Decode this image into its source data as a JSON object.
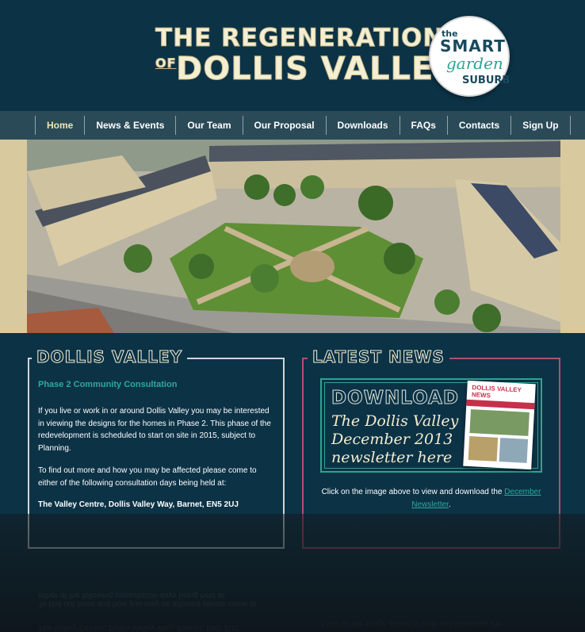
{
  "header": {
    "title_line1": "THE REGENERATION",
    "title_of": "OF",
    "title_line2": "DOLLIS VALLEY",
    "badge": {
      "the": "the",
      "smart": "SMART",
      "garden": "garden",
      "suburb": "SUBURB"
    }
  },
  "nav": {
    "items": [
      {
        "label": "Home",
        "active": true
      },
      {
        "label": "News & Events"
      },
      {
        "label": "Our Team"
      },
      {
        "label": "Our Proposal"
      },
      {
        "label": "Downloads"
      },
      {
        "label": "FAQs"
      },
      {
        "label": "Contacts"
      },
      {
        "label": "Sign Up"
      }
    ]
  },
  "left": {
    "title": "DOLLIS VALLEY",
    "heading": "Phase 2 Community Consultation",
    "para1": "If you live or work in or around Dollis Valley you may be interested in viewing the designs for the homes in Phase 2. This phase of the redevelopment is scheduled to start on site in 2015, subject to Planning.",
    "para2": "To find out more and how you may be affected please come to either of the following consultation days being held at:",
    "venue": "The Valley Centre, Dollis Valley Way, Barnet, EN5 2UJ"
  },
  "right": {
    "title": "LATEST NEWS",
    "download_word": "DOWNLOAD",
    "download_line1": "The Dollis Valley",
    "download_line2": "December 2013",
    "download_line3": "newsletter here",
    "newsletter_masthead": "DOLLIS VALLEY NEWS",
    "caption_prefix": "Click on the image above to view and download the ",
    "caption_link": "December Newsletter",
    "caption_suffix": "."
  },
  "colors": {
    "background": "#0c3246",
    "nav": "#2a4a57",
    "accent_teal": "#2bab9b",
    "accent_pink": "#b0506f",
    "cream": "#f4efd2"
  }
}
